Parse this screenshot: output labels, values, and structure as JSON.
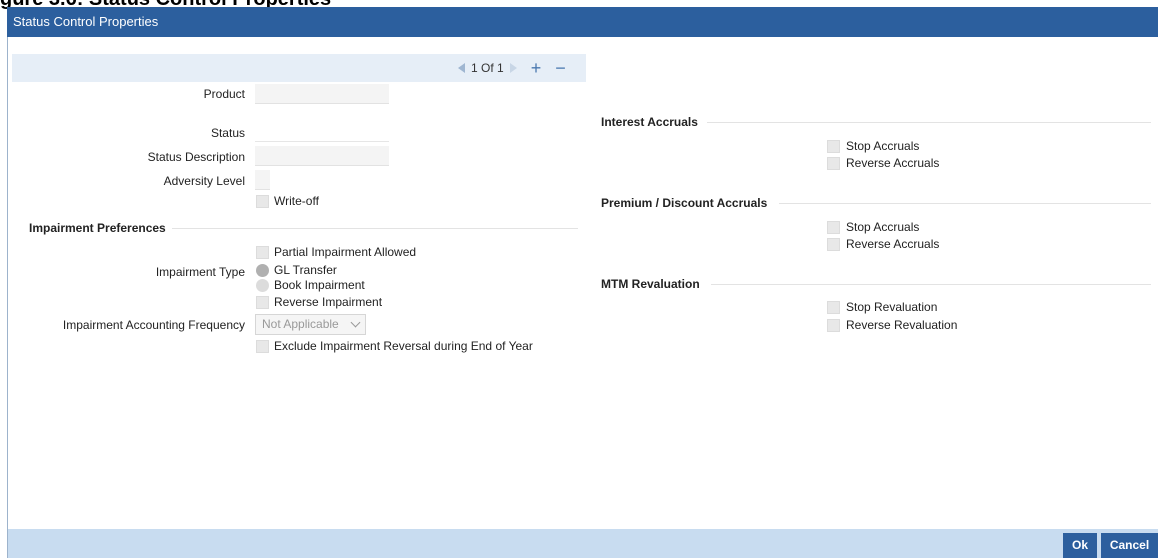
{
  "caption": "gure 3.6: Status Control Properties",
  "window": {
    "title": "Status Control Properties"
  },
  "pager": {
    "text": "1 Of 1",
    "add": "+",
    "remove": "−"
  },
  "form": {
    "product_label": "Product",
    "status_label": "Status",
    "status_description_label": "Status Description",
    "adversity_level_label": "Adversity Level",
    "writeoff_label": "Write-off"
  },
  "impairment": {
    "heading": "Impairment Preferences",
    "partial_label": "Partial Impairment Allowed",
    "type_label": "Impairment Type",
    "gl_transfer": "GL Transfer",
    "book_impairment": "Book Impairment",
    "reverse_impairment": "Reverse Impairment",
    "frequency_label": "Impairment Accounting Frequency",
    "frequency_value": "Not Applicable",
    "exclude_label": "Exclude Impairment Reversal during End of Year"
  },
  "interest_accruals": {
    "heading": "Interest Accruals",
    "stop": "Stop Accruals",
    "reverse": "Reverse Accruals"
  },
  "premium_discount": {
    "heading": "Premium / Discount Accruals",
    "stop": "Stop Accruals",
    "reverse": "Reverse Accruals"
  },
  "mtm": {
    "heading": "MTM Revaluation",
    "stop": "Stop Revaluation",
    "reverse": "Reverse Revaluation"
  },
  "footer": {
    "ok": "Ok",
    "cancel": "Cancel"
  },
  "colors": {
    "title_bar": "#2c5f9e",
    "footer_bar": "#c8dcf0",
    "pager_bar": "#e6eef7"
  }
}
